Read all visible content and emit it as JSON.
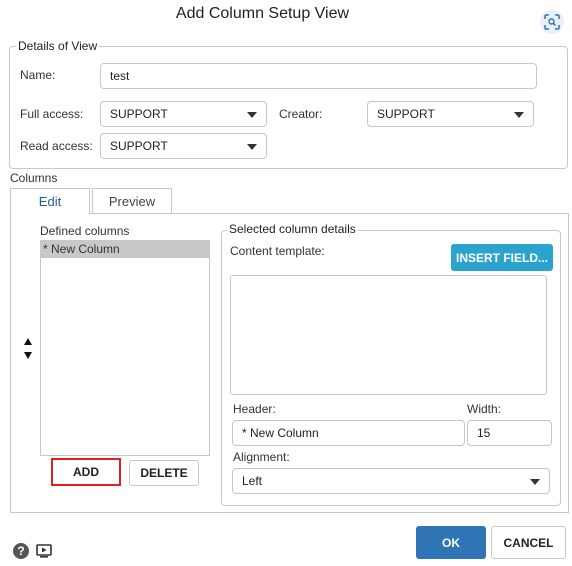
{
  "dialog": {
    "title": "Add Column Setup View"
  },
  "details": {
    "legend": "Details of View",
    "name_label": "Name:",
    "name_value": "test",
    "full_access_label": "Full access:",
    "full_access_value": "SUPPORT",
    "creator_label": "Creator:",
    "creator_value": "SUPPORT",
    "read_access_label": "Read access:",
    "read_access_value": "SUPPORT"
  },
  "columns": {
    "label": "Columns",
    "tabs": [
      {
        "label": "Edit",
        "active": true
      },
      {
        "label": "Preview",
        "active": false
      }
    ],
    "defined_label": "Defined columns",
    "defined_items": [
      "* New Column"
    ],
    "add_label": "ADD",
    "delete_label": "DELETE"
  },
  "selected": {
    "legend": "Selected column details",
    "content_template_label": "Content template:",
    "insert_field_label": "INSERT FIELD...",
    "header_label": "Header:",
    "header_value": "* New Column",
    "width_label": "Width:",
    "width_value": "15",
    "alignment_label": "Alignment:",
    "alignment_value": "Left"
  },
  "footer": {
    "ok_label": "OK",
    "cancel_label": "CANCEL"
  },
  "icons": {
    "scan": "scan-icon",
    "up": "arrow-up-icon",
    "down": "arrow-down-icon",
    "help": "help-icon",
    "video": "video-icon"
  },
  "colors": {
    "primary": "#2f74b5",
    "insert": "#2aa3cf",
    "highlight": "#e02020",
    "selected_row": "#c8c8c8",
    "tab_active": "#1f5c99"
  }
}
